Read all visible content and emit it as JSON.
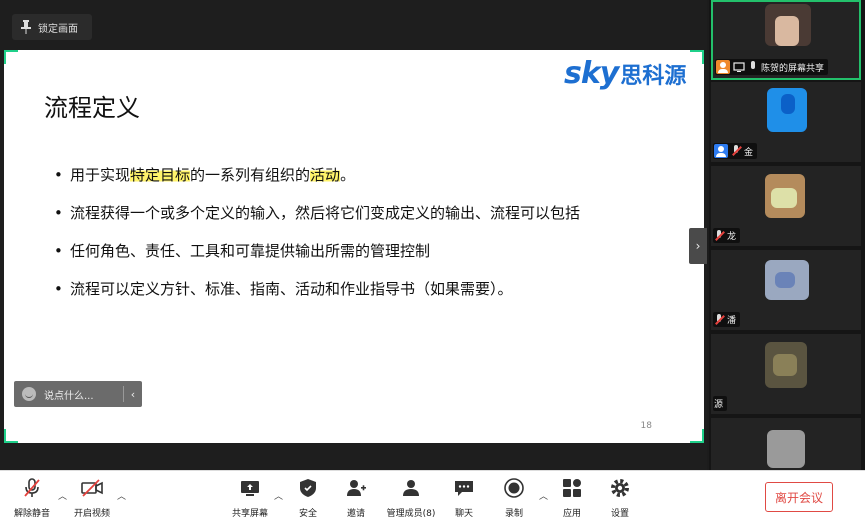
{
  "lock_screen": {
    "label": "锁定画面"
  },
  "slide": {
    "title": "流程定义",
    "logo": {
      "latin": "sky",
      "chinese": "思科源"
    },
    "bullets": [
      {
        "before": "用于实现",
        "highlight1": "特定目标",
        "middle": "的一系列有组织的",
        "highlight2": "活动",
        "after": "。"
      },
      {
        "text": "流程获得一个或多个定义的输入，然后将它们变成定义的输出、流程可以包括"
      },
      {
        "text": "任何角色、责任、工具和可靠提供输出所需的管理控制"
      },
      {
        "text": "流程可以定义方针、标准、指南、活动和作业指导书（如果需要）。"
      }
    ],
    "page_number": "18",
    "highlight_color": "#fff36b"
  },
  "chat_input": {
    "placeholder": "说点什么..."
  },
  "participants": [
    {
      "name": "陈贺的屏幕共享",
      "active": true
    },
    {
      "name": "金"
    },
    {
      "name": "龙"
    },
    {
      "name": "潘"
    },
    {
      "name": "源"
    },
    {
      "name": ""
    }
  ],
  "toolbar": {
    "unmute": "解除静音",
    "start_video": "开启视频",
    "share_screen": "共享屏幕",
    "security": "安全",
    "invite": "邀请",
    "manage_members": "管理成员(8)",
    "chat": "聊天",
    "record": "录制",
    "apps": "应用",
    "settings": "设置",
    "leave": "离开会议"
  },
  "colors": {
    "accent_green": "#1fd08a",
    "leave_red": "#e04a44",
    "logo_blue": "#1d6fd1"
  }
}
